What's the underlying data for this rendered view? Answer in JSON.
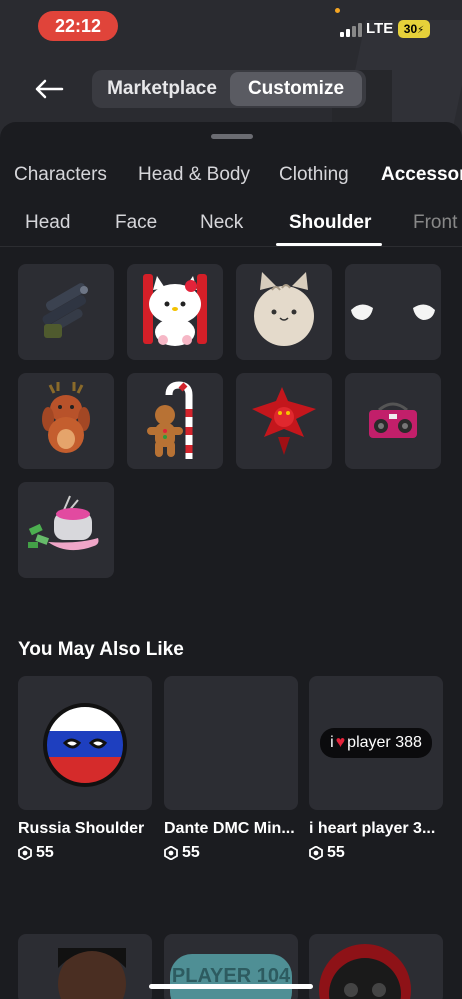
{
  "status": {
    "time": "22:12",
    "network": "LTE",
    "battery": "30"
  },
  "header": {
    "segments": [
      {
        "label": "Marketplace",
        "active": false
      },
      {
        "label": "Customize",
        "active": true
      }
    ]
  },
  "category_tabs": [
    "Characters",
    "Head & Body",
    "Clothing",
    "Accessor"
  ],
  "sub_tabs": [
    "Head",
    "Face",
    "Neck",
    "Shoulder",
    "Front"
  ],
  "selected_sub_tab": "Shoulder",
  "items": [
    {
      "icon": "rocket-launcher-shoulder-icon"
    },
    {
      "icon": "hello-kitty-icon"
    },
    {
      "icon": "cat-plush-icon"
    },
    {
      "icon": "wings-icon"
    },
    {
      "icon": "reindeer-pet-icon"
    },
    {
      "icon": "gingerbread-candy-cane-icon"
    },
    {
      "icon": "red-dragon-icon"
    },
    {
      "icon": "boombox-icon"
    },
    {
      "icon": "money-boombox-icon"
    }
  ],
  "recommendations": {
    "title": "You May Also Like",
    "cards": [
      {
        "name": "Russia Shoulder",
        "price": "55",
        "icon": "russia-ball-icon"
      },
      {
        "name": "Dante DMC Min...",
        "price": "55",
        "icon": "empty-thumbnail"
      },
      {
        "name": "i heart player 3...",
        "price": "55",
        "icon": "heart-player-sign-icon",
        "sign_prefix": "i",
        "sign_text": "player 388"
      }
    ],
    "row2_partial_text": "PLAYER 104"
  },
  "colors": {
    "accent_time": "#e0443a",
    "battery": "#e6d13a",
    "sheet": "#1b1c20",
    "tile": "#2c2d33"
  }
}
